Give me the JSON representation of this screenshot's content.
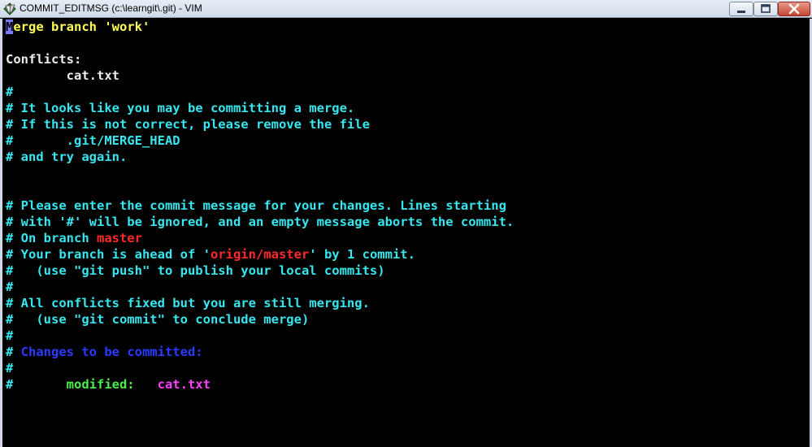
{
  "window": {
    "title": "COMMIT_EDITMSG (c:\\learngit\\.git) - VIM",
    "icon": "vim-icon"
  },
  "editor": {
    "lines": [
      {
        "segments": [
          {
            "text": "M",
            "color": "cursor"
          },
          {
            "text": "erge branch 'work'",
            "color": "yellow"
          }
        ]
      },
      {
        "segments": []
      },
      {
        "segments": [
          {
            "text": "Conflicts:",
            "color": "white"
          }
        ]
      },
      {
        "segments": [
          {
            "text": "        cat.txt",
            "color": "white"
          }
        ]
      },
      {
        "segments": [
          {
            "text": "#",
            "color": "cyan"
          }
        ]
      },
      {
        "segments": [
          {
            "text": "# It looks like you may be committing a merge.",
            "color": "cyan"
          }
        ]
      },
      {
        "segments": [
          {
            "text": "# If this is not correct, please remove the file",
            "color": "cyan"
          }
        ]
      },
      {
        "segments": [
          {
            "text": "#       .git/MERGE_HEAD",
            "color": "cyan"
          }
        ]
      },
      {
        "segments": [
          {
            "text": "# and try again.",
            "color": "cyan"
          }
        ]
      },
      {
        "segments": []
      },
      {
        "segments": []
      },
      {
        "segments": [
          {
            "text": "# Please enter the commit message for your changes. Lines starting",
            "color": "cyan"
          }
        ]
      },
      {
        "segments": [
          {
            "text": "# with '#' will be ignored, and an empty message aborts the commit.",
            "color": "cyan"
          }
        ]
      },
      {
        "segments": [
          {
            "text": "# On branch ",
            "color": "cyan"
          },
          {
            "text": "master",
            "color": "red"
          }
        ]
      },
      {
        "segments": [
          {
            "text": "# Your branch is ahead of '",
            "color": "cyan"
          },
          {
            "text": "origin/master",
            "color": "red"
          },
          {
            "text": "' by 1 commit.",
            "color": "cyan"
          }
        ]
      },
      {
        "segments": [
          {
            "text": "#   (use \"git push\" to publish your local commits)",
            "color": "cyan"
          }
        ]
      },
      {
        "segments": [
          {
            "text": "#",
            "color": "cyan"
          }
        ]
      },
      {
        "segments": [
          {
            "text": "# All conflicts fixed but you are still merging.",
            "color": "cyan"
          }
        ]
      },
      {
        "segments": [
          {
            "text": "#   (use \"git commit\" to conclude merge)",
            "color": "cyan"
          }
        ]
      },
      {
        "segments": [
          {
            "text": "#",
            "color": "cyan"
          }
        ]
      },
      {
        "segments": [
          {
            "text": "# ",
            "color": "cyan"
          },
          {
            "text": "Changes to be committed:",
            "color": "blue"
          }
        ]
      },
      {
        "segments": [
          {
            "text": "#",
            "color": "cyan"
          }
        ]
      },
      {
        "segments": [
          {
            "text": "#       ",
            "color": "cyan"
          },
          {
            "text": "modified:   ",
            "color": "green"
          },
          {
            "text": "cat.txt",
            "color": "magenta"
          }
        ]
      }
    ]
  },
  "colors": {
    "yellow": "#ffff55",
    "white": "#ececec",
    "cyan": "#37e6ef",
    "red": "#ff2a2a",
    "blue": "#2a3bff",
    "magenta": "#ff40ff",
    "green": "#4cf04c"
  }
}
